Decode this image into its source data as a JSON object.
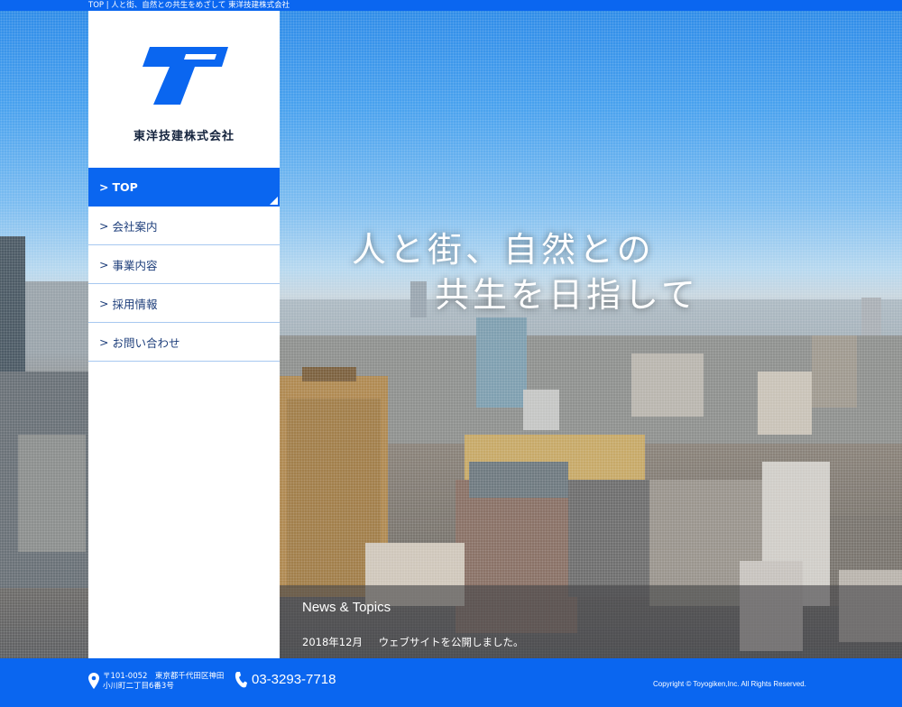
{
  "topbar": {
    "text": "TOP | 人と街、自然との共生をめざして 東洋技建株式会社"
  },
  "sidebar": {
    "company_name": "東洋技建株式会社",
    "nav": [
      {
        "label": "TOP",
        "prefix": ">"
      },
      {
        "label": "会社案内",
        "prefix": ">"
      },
      {
        "label": "事業内容",
        "prefix": ">"
      },
      {
        "label": "採用情報",
        "prefix": ">"
      },
      {
        "label": "お問い合わせ",
        "prefix": ">"
      }
    ]
  },
  "hero": {
    "tagline_line1": "人と街、自然との",
    "tagline_line2": "共生を日指して"
  },
  "news": {
    "heading": "News & Topics",
    "items": [
      {
        "date": "2018年12月",
        "text": "ウェブサイトを公開しました。"
      }
    ]
  },
  "footer": {
    "postal": "〒101-0052　東京都千代田区神田",
    "address": "小川町二丁目6番3号",
    "phone": "03-3293-7718",
    "copyright": "Copyright © Toyogiken,Inc. All Rights Reserved."
  },
  "colors": {
    "brand_blue": "#0a66f0",
    "nav_text": "#1c3d7a"
  },
  "icons": [
    "logo-mark",
    "location-pin-icon",
    "phone-icon"
  ]
}
